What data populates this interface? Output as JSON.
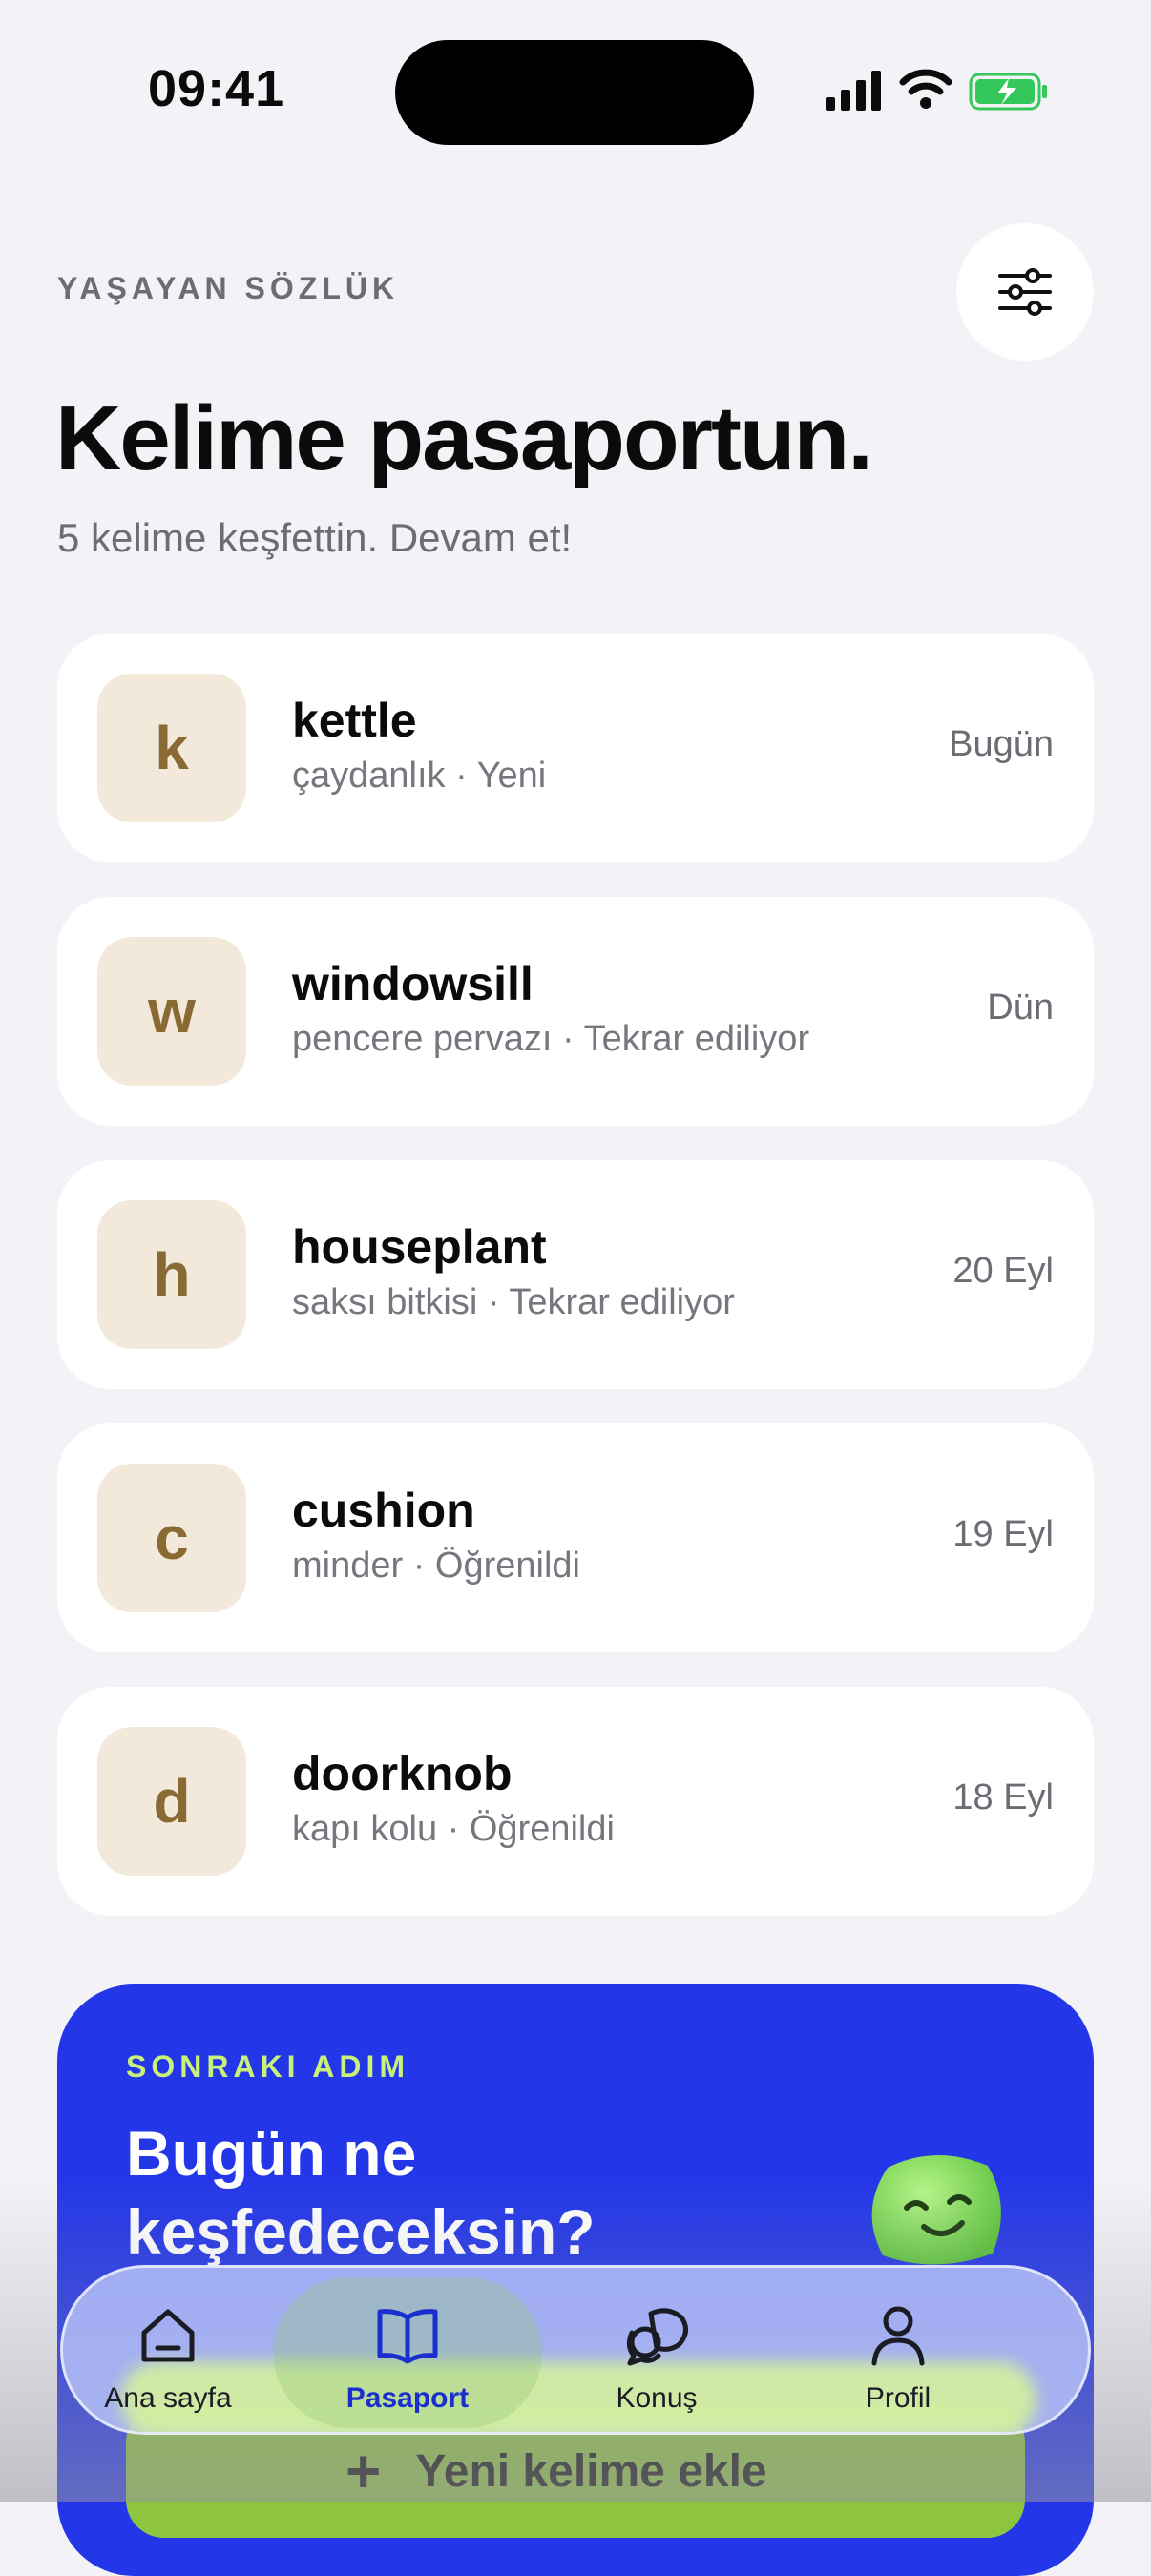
{
  "status_bar": {
    "time": "09:41"
  },
  "header": {
    "eyebrow": "YAŞAYAN SÖZLÜK",
    "title": "Kelime pasaportun.",
    "subtitle": "5 kelime keşfettin. Devam et!"
  },
  "words": [
    {
      "letter": "k",
      "word": "kettle",
      "meta": "çaydanlık · Yeni",
      "date": "Bugün"
    },
    {
      "letter": "w",
      "word": "windowsill",
      "meta": "pencere pervazı · Tekrar ediliyor",
      "date": "Dün"
    },
    {
      "letter": "h",
      "word": "houseplant",
      "meta": "saksı bitkisi · Tekrar ediliyor",
      "date": "20 Eyl"
    },
    {
      "letter": "c",
      "word": "cushion",
      "meta": "minder · Öğrenildi",
      "date": "19 Eyl"
    },
    {
      "letter": "d",
      "word": "doorknob",
      "meta": "kapı kolu · Öğrenildi",
      "date": "18 Eyl"
    }
  ],
  "next_step": {
    "eyebrow": "SONRAKI ADIM",
    "title": "Bugün ne keşfedeceksin?",
    "button_label": "Yeni kelime ekle"
  },
  "tabs": [
    {
      "label": "Ana sayfa",
      "icon": "home-icon"
    },
    {
      "label": "Pasaport",
      "icon": "book-icon",
      "active": true
    },
    {
      "label": "Konuş",
      "icon": "chat-icon"
    },
    {
      "label": "Profil",
      "icon": "person-icon"
    }
  ],
  "colors": {
    "accent": "#2437e8",
    "lime": "#c8f07a",
    "badge_bg": "#f2e9da",
    "badge_text": "#8a6a33"
  }
}
